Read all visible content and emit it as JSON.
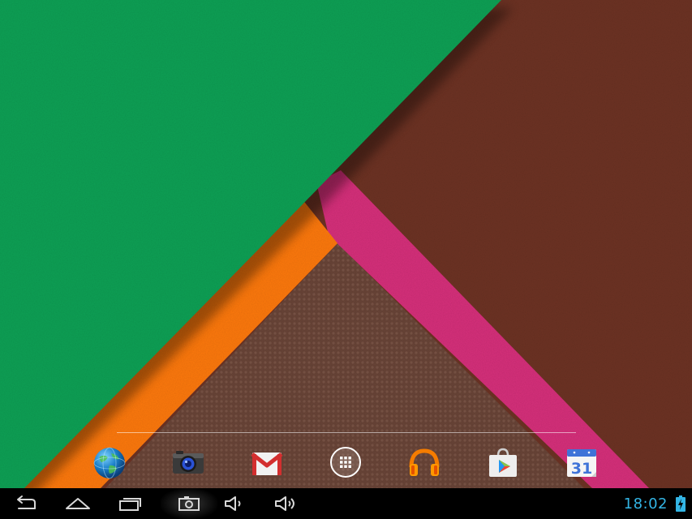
{
  "status_bar": {
    "time": "18:02"
  },
  "dock": {
    "apps": [
      {
        "icon": "browser-globe-icon"
      },
      {
        "icon": "camera-icon"
      },
      {
        "icon": "gmail-icon"
      },
      {
        "icon": "app-drawer-icon"
      },
      {
        "icon": "play-music-headphones-icon"
      },
      {
        "icon": "play-store-icon"
      },
      {
        "icon": "calendar-icon",
        "day": "31"
      }
    ]
  },
  "navbar": {
    "buttons": [
      "back-icon",
      "home-icon",
      "recent-apps-icon",
      "screenshot-icon",
      "volume-down-icon",
      "volume-up-icon"
    ]
  },
  "colors": {
    "wallpaper_green": "#0ea256",
    "wallpaper_brown": "#6e3324",
    "wallpaper_pink": "#d8307c",
    "wallpaper_orange": "#ff7a0d",
    "wallpaper_texture_brown": "#6a4538",
    "clock_blue": "#33b5e5"
  }
}
